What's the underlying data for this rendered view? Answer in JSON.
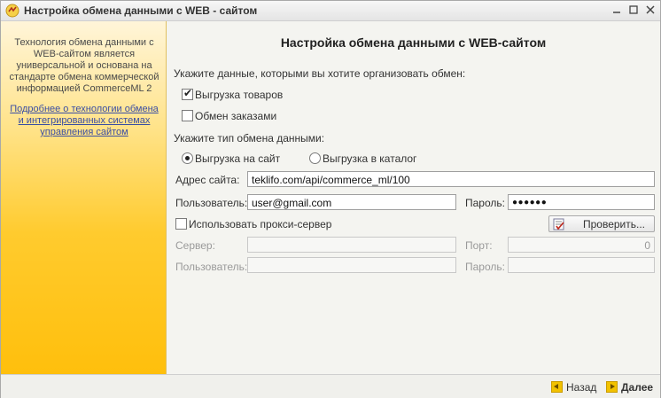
{
  "window": {
    "title": "Настройка обмена данными с WEB - сайтом",
    "controls": [
      "minimize",
      "maximize",
      "close"
    ]
  },
  "sidebar": {
    "description": "Технология обмена данными с WEB-сайтом является универсальной и основана на стандарте обмена коммерческой информацией CommerceML 2",
    "link": "Подробнее о технологии обмена и интегрированных системах управления сайтом"
  },
  "main": {
    "heading": "Настройка обмена данными с WEB-сайтом",
    "choose_data_label": "Укажите данные, которыми вы хотите организовать обмен:",
    "upload_goods": {
      "label": "Выгрузка товаров",
      "checked": true
    },
    "exchange_orders": {
      "label": "Обмен заказами",
      "checked": false
    },
    "exchange_type_label": "Укажите тип обмена данными:",
    "radio_site": {
      "label": "Выгрузка на сайт",
      "selected": true
    },
    "radio_catalog": {
      "label": "Выгрузка в каталог",
      "selected": false
    },
    "site_address": {
      "label": "Адрес сайта:",
      "value": "teklifo.com/api/commerce_ml/100"
    },
    "user": {
      "label": "Пользователь:",
      "value": "user@gmail.com"
    },
    "password": {
      "label": "Пароль:",
      "value": "●●●●●●"
    },
    "use_proxy": {
      "label": "Использовать прокси-сервер",
      "checked": false
    },
    "check_button": "Проверить...",
    "proxy": {
      "server_label": "Сервер:",
      "port_label": "Порт:",
      "port_value": "0",
      "user_label": "Пользователь:",
      "password_label": "Пароль:"
    }
  },
  "footer": {
    "back": "Назад",
    "next": "Далее"
  },
  "colors": {
    "sidebar_gradient_end": "#ffbf0c",
    "link": "#3a4ea3"
  }
}
